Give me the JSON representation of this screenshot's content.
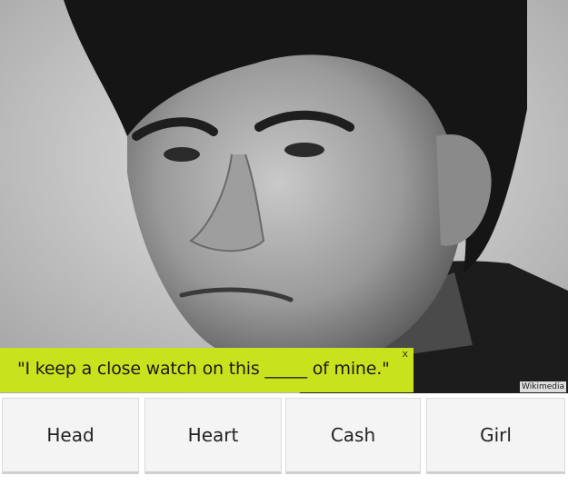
{
  "question": {
    "text": "\"I keep a close watch on this _____ of mine.\"",
    "close_label": "x",
    "banner_color": "#c8e31d"
  },
  "photo": {
    "credit": "Wikimedia",
    "style": "black-and-white"
  },
  "answers": [
    {
      "label": "Head"
    },
    {
      "label": "Heart"
    },
    {
      "label": "Cash"
    },
    {
      "label": "Girl"
    }
  ]
}
